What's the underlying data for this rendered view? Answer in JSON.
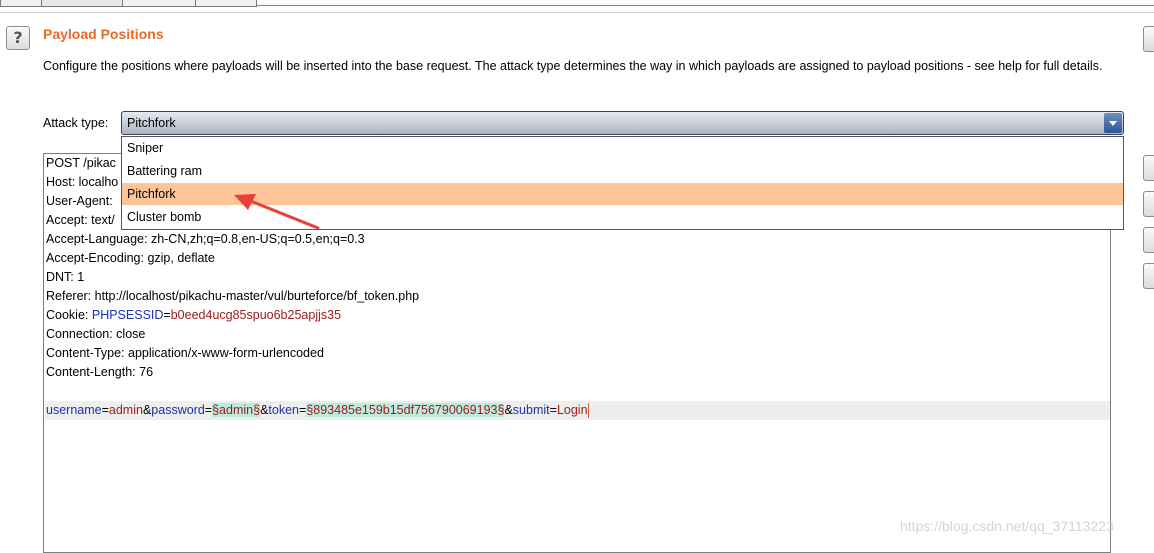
{
  "panel": {
    "title": "Payload Positions",
    "description": "Configure the positions where payloads will be inserted into the base request. The attack type determines the way in which payloads are assigned to payload positions - see help for full details.",
    "help_icon": "?"
  },
  "attack_type": {
    "label": "Attack type:",
    "selected": "Pitchfork",
    "options": [
      "Sniper",
      "Battering ram",
      "Pitchfork",
      "Cluster bomb"
    ]
  },
  "request": {
    "line1_visible": "POST /pikac",
    "line2_visible": "Host: localho",
    "line3_visible": "User-Agent: ",
    "line4_visible": "Accept: text/",
    "accept_language": "Accept-Language: zh-CN,zh;q=0.8,en-US;q=0.5,en;q=0.3",
    "accept_encoding": "Accept-Encoding: gzip, deflate",
    "dnt": "DNT: 1",
    "referer": "Referer: http://localhost/pikachu-master/vul/burteforce/bf_token.php",
    "cookie_prefix": "Cookie: ",
    "cookie_name": "PHPSESSID",
    "cookie_eq": "=",
    "cookie_value": "b0eed4ucg85spuo6b25apjjs35",
    "connection": "Connection: close",
    "content_type": "Content-Type: application/x-www-form-urlencoded",
    "content_length": "Content-Length: 76",
    "body": {
      "k1": "username",
      "eq1": "=",
      "v1": "admin",
      "amp1": "&",
      "k2": "password",
      "eq2": "=",
      "p1": "§admin§",
      "amp2": "&",
      "k3": "token",
      "eq3": "=",
      "p2": "§893485e159b15df756790069193§",
      "amp3": "&",
      "k4": "submit",
      "eq4": "=",
      "v4": "Login"
    }
  },
  "watermark": "https://blog.csdn.net/qq_37113223",
  "colors": {
    "title": "#e8692a",
    "selected_option": "#ffc598",
    "payload_marker_bg": "#b9ecdf",
    "param_name": "#1a33a8",
    "param_value": "#a01c1c",
    "annotation_arrow": "#e8403a"
  }
}
